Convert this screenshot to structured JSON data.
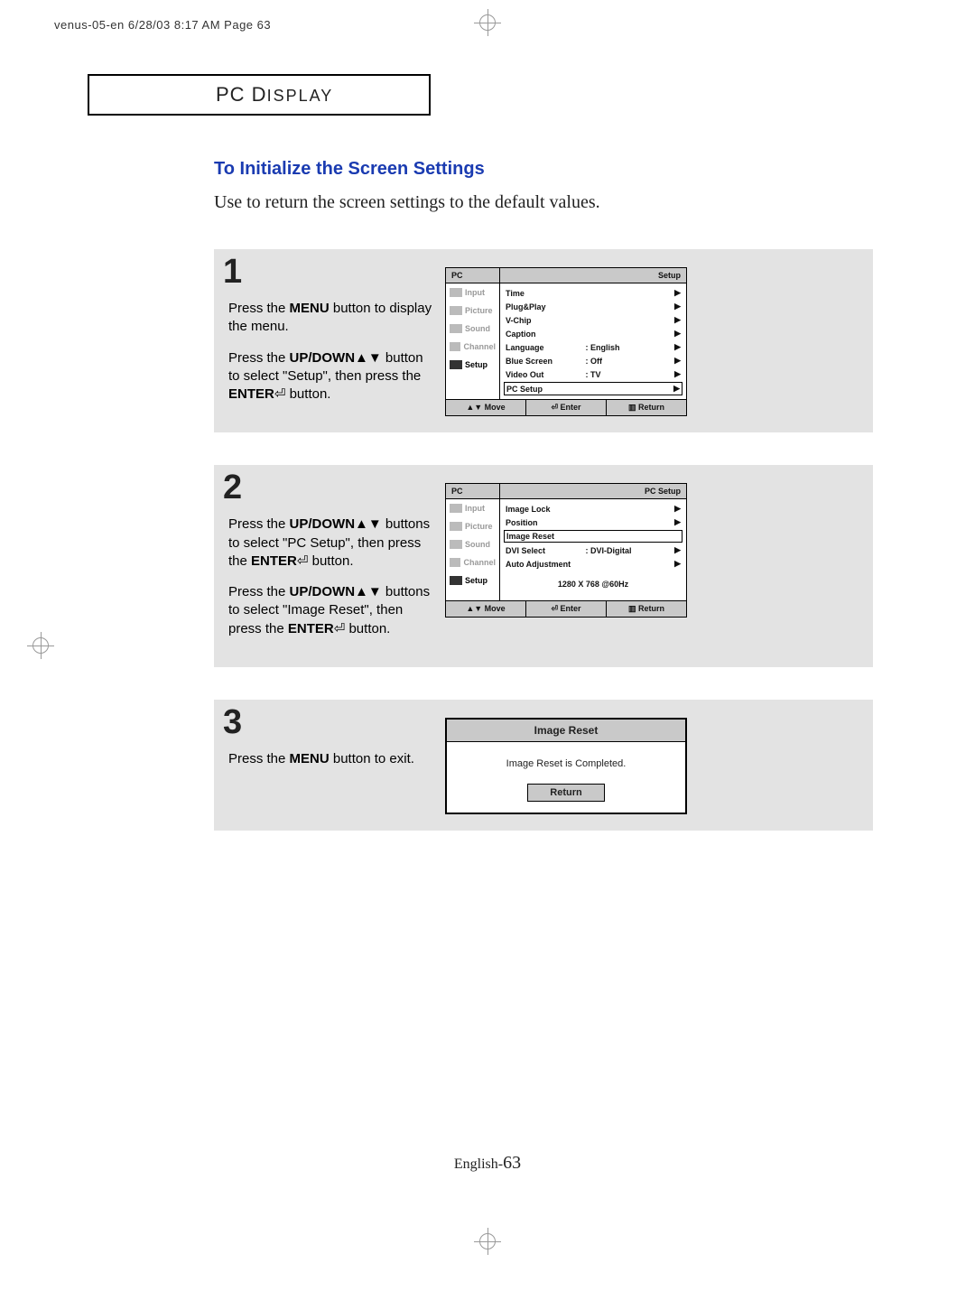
{
  "scan_header": "venus-05-en  6/28/03  8:17 AM  Page 63",
  "section_title_main": "PC D",
  "section_title_small": "ISPLAY",
  "heading": "To Initialize the Screen Settings",
  "intro": "Use to return the screen settings to the default values.",
  "step1": {
    "num": "1",
    "p1a": "Press the ",
    "p1b": "MENU",
    "p1c": " button to display the menu.",
    "p2a": "Press the ",
    "p2b": "UP/DOWN",
    "p2c": " button to select \"Setup\", then press the ",
    "p2d": "ENTER",
    "p2e": " button."
  },
  "step2": {
    "num": "2",
    "p1a": "Press the ",
    "p1b": "UP/DOWN",
    "p1c": " buttons to select \"PC Setup\", then press the ",
    "p1d": "ENTER",
    "p1e": " button.",
    "p2a": "Press the ",
    "p2b": "UP/DOWN",
    "p2c": " buttons to select \"Image Reset\", then press the ",
    "p2d": "ENTER",
    "p2e": "  button."
  },
  "step3": {
    "num": "3",
    "p1a": "Press the ",
    "p1b": "MENU",
    "p1c": " button to exit."
  },
  "osd1": {
    "head_left": "PC",
    "head_right": "Setup",
    "sidebar": [
      "Input",
      "Picture",
      "Sound",
      "Channel",
      "Setup"
    ],
    "rows": [
      {
        "lbl": "Time",
        "mid": "",
        "val": "",
        "arrow": "▶"
      },
      {
        "lbl": "Plug&Play",
        "mid": "",
        "val": "",
        "arrow": "▶"
      },
      {
        "lbl": "V-Chip",
        "mid": "",
        "val": "",
        "arrow": "▶"
      },
      {
        "lbl": "Caption",
        "mid": "",
        "val": "",
        "arrow": "▶"
      },
      {
        "lbl": "Language",
        "mid": ":",
        "val": "English",
        "arrow": "▶"
      },
      {
        "lbl": "Blue Screen",
        "mid": ":",
        "val": "Off",
        "arrow": "▶"
      },
      {
        "lbl": "Video Out",
        "mid": ":",
        "val": "TV",
        "arrow": "▶"
      },
      {
        "lbl": "PC Setup",
        "mid": "",
        "val": "",
        "arrow": "▶",
        "boxed": true
      }
    ],
    "foot": [
      "▲▼ Move",
      "⏎ Enter",
      "▥ Return"
    ]
  },
  "osd2": {
    "head_left": "PC",
    "head_right": "PC Setup",
    "sidebar": [
      "Input",
      "Picture",
      "Sound",
      "Channel",
      "Setup"
    ],
    "rows": [
      {
        "lbl": "Image Lock",
        "mid": "",
        "val": "",
        "arrow": "▶"
      },
      {
        "lbl": "Position",
        "mid": "",
        "val": "",
        "arrow": "▶"
      },
      {
        "lbl": "Image Reset",
        "mid": "",
        "val": "",
        "arrow": "",
        "boxed": true
      },
      {
        "lbl": "DVI Select",
        "mid": ":",
        "val": "DVI-Digital",
        "arrow": "▶"
      },
      {
        "lbl": "Auto Adjustment",
        "mid": "",
        "val": "",
        "arrow": "▶"
      }
    ],
    "center": "1280 X 768 @60Hz",
    "foot": [
      "▲▼ Move",
      "⏎ Enter",
      "▥ Return"
    ]
  },
  "dialog": {
    "title": "Image Reset",
    "msg": "Image Reset is Completed.",
    "btn": "Return"
  },
  "page_number_prefix": "English-",
  "page_number": "63"
}
